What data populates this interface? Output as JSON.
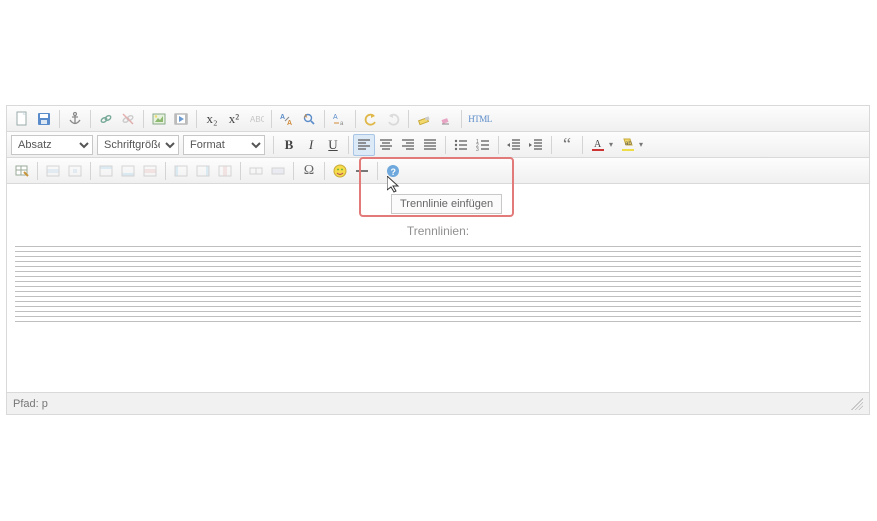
{
  "selects": {
    "paragraph": "Absatz",
    "fontsize": "Schriftgröße",
    "format": "Format"
  },
  "tooltip": "Trennlinie einfügen",
  "content": {
    "caption": "Trennlinien:"
  },
  "status": {
    "path_label": "Pfad:",
    "path_value": "p"
  },
  "html_label": "HTML",
  "omega": "Ω",
  "quote": "“",
  "subscript": "x₂",
  "superscript": "x²"
}
